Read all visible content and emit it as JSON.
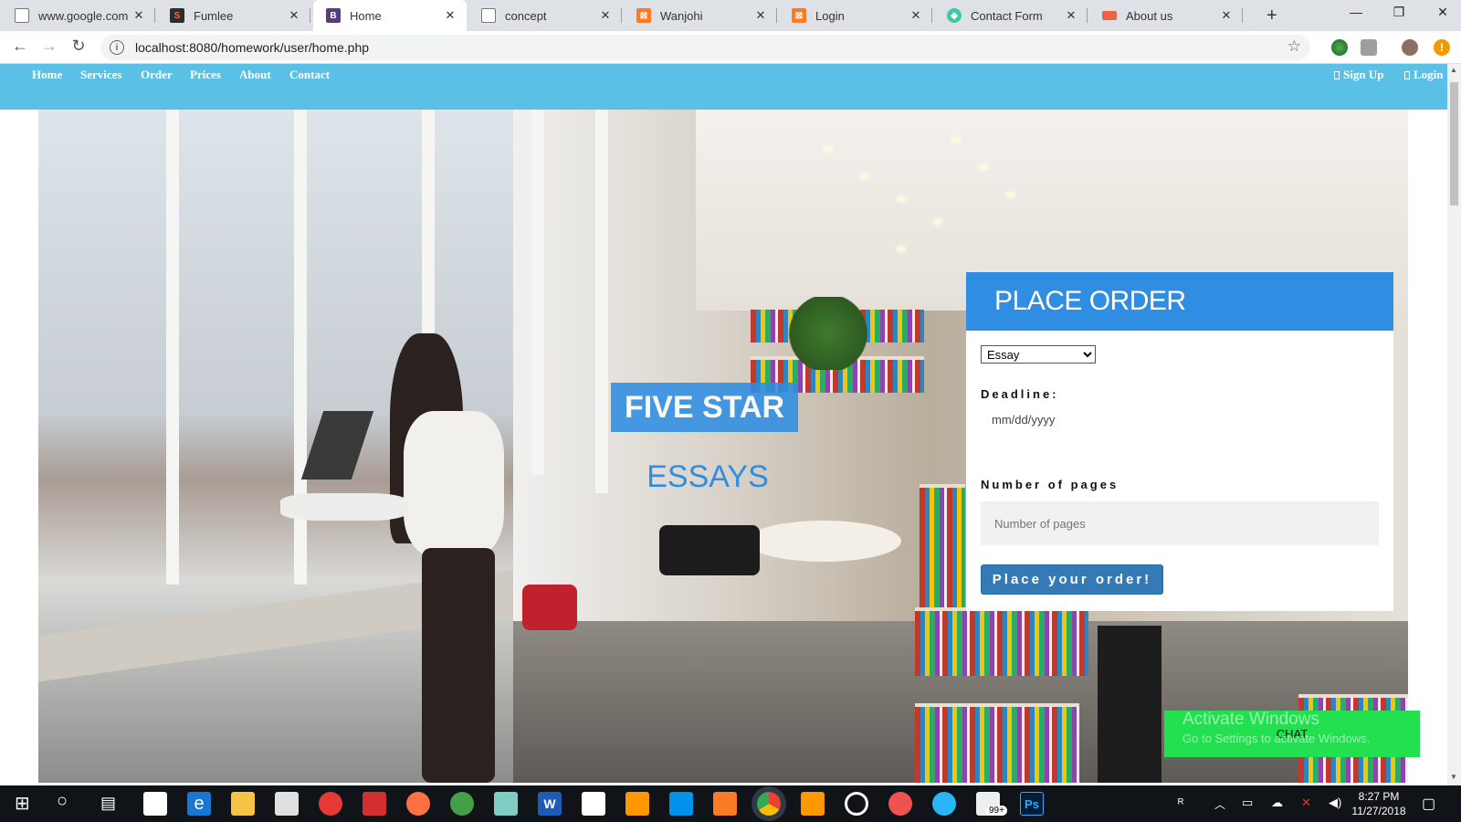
{
  "browser": {
    "tabs": [
      {
        "label": "www.google.com",
        "favicon": "page-icon",
        "color": "#9aa0a6"
      },
      {
        "label": "Fumlee",
        "favicon": "sublime-icon",
        "color": "#2d2d2d"
      },
      {
        "label": "Home",
        "favicon": "bootstrap-icon",
        "color": "#563d7c"
      },
      {
        "label": "concept",
        "favicon": "page-icon",
        "color": "#9aa0a6"
      },
      {
        "label": "Wanjohi",
        "favicon": "xampp-icon",
        "color": "#fb7a24"
      },
      {
        "label": "Login",
        "favicon": "xampp-icon",
        "color": "#fb7a24"
      },
      {
        "label": "Contact Form",
        "favicon": "gem-icon",
        "color": "#3cc9a6"
      },
      {
        "label": "About us",
        "favicon": "flag-icon",
        "color": "#e8644a"
      }
    ],
    "active_tab": 2,
    "url": "localhost:8080/homework/user/home.php"
  },
  "site_nav": {
    "left": [
      "Home",
      "Services",
      "Order",
      "Prices",
      "About",
      "Contact"
    ],
    "right": [
      "Sign Up",
      "Login"
    ]
  },
  "hero": {
    "title_line1": "FIVE STAR",
    "title_line2": "ESSAYS"
  },
  "order_form": {
    "heading": "PLACE ORDER",
    "type_selected": "Essay",
    "deadline_label": "Deadline:",
    "deadline_placeholder": "mm/dd/yyyy",
    "pages_label": "Number of pages",
    "pages_placeholder": "Number of pages",
    "submit_label": "Place your order!"
  },
  "chat": {
    "label": "CHAT"
  },
  "watermark": {
    "line1": "Activate Windows",
    "line2": "Go to Settings to activate Windows."
  },
  "taskbar": {
    "time": "8:27 PM",
    "date": "11/27/2018",
    "badge": "99+"
  },
  "colors": {
    "nav": "#5bc0e5",
    "accent": "#2f8ee2",
    "button": "#337ab7",
    "chat": "#22e04f"
  }
}
